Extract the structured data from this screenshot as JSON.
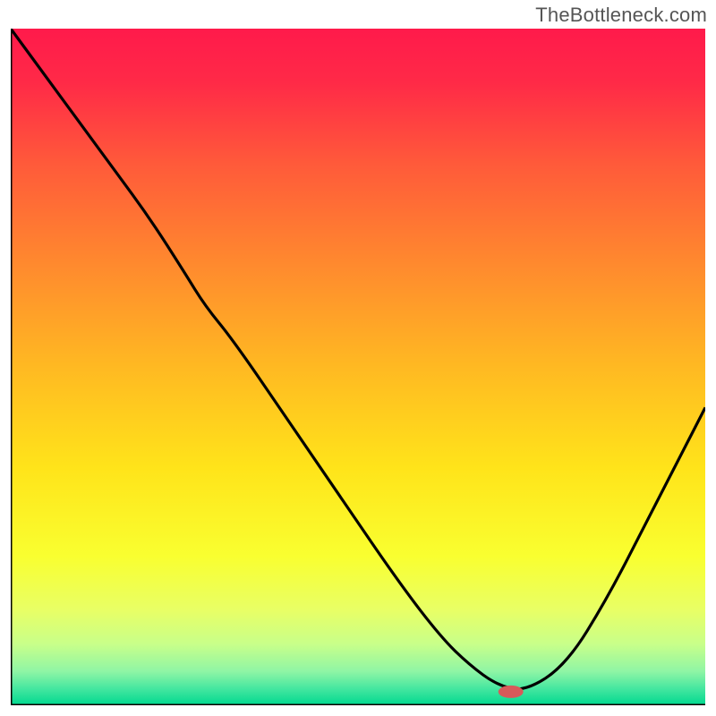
{
  "watermark": "TheBottleneck.com",
  "chart_data": {
    "type": "line",
    "title": "",
    "xlabel": "",
    "ylabel": "",
    "xlim": [
      0,
      100
    ],
    "ylim": [
      0,
      100
    ],
    "grid": false,
    "legend": false,
    "gradient_stops": [
      {
        "offset": 0.0,
        "color": "#ff1a4b"
      },
      {
        "offset": 0.08,
        "color": "#ff2a47"
      },
      {
        "offset": 0.2,
        "color": "#ff5a3a"
      },
      {
        "offset": 0.35,
        "color": "#ff8a2e"
      },
      {
        "offset": 0.5,
        "color": "#ffb922"
      },
      {
        "offset": 0.65,
        "color": "#ffe41a"
      },
      {
        "offset": 0.78,
        "color": "#f9ff30"
      },
      {
        "offset": 0.86,
        "color": "#e8ff66"
      },
      {
        "offset": 0.91,
        "color": "#c8ff8a"
      },
      {
        "offset": 0.95,
        "color": "#8ff5a5"
      },
      {
        "offset": 0.975,
        "color": "#46e7a0"
      },
      {
        "offset": 1.0,
        "color": "#00d88f"
      }
    ],
    "series": [
      {
        "name": "bottleneck-curve",
        "color": "#000000",
        "x": [
          0,
          5,
          10,
          15,
          20,
          25,
          28,
          32,
          40,
          48,
          56,
          62,
          66,
          70,
          74,
          80,
          86,
          92,
          96,
          100
        ],
        "y": [
          100,
          93,
          86,
          79,
          72,
          64,
          59,
          54,
          42,
          30,
          18,
          10,
          6,
          3,
          2,
          6,
          16,
          28,
          36,
          44
        ]
      }
    ],
    "marker": {
      "name": "optimal-point",
      "x": 72,
      "y": 2,
      "color": "#d85a5a",
      "rx": 14,
      "ry": 7
    }
  }
}
